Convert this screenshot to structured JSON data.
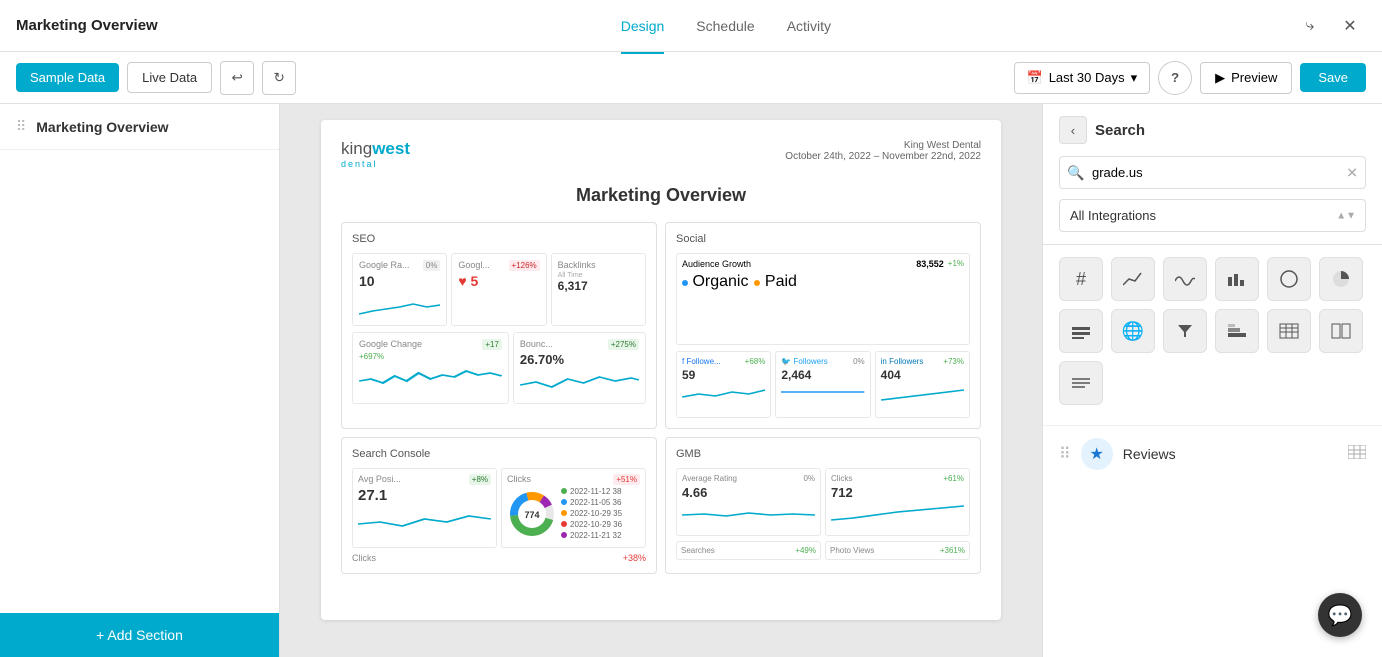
{
  "header": {
    "title": "Marketing Overview",
    "nav": [
      {
        "label": "Design",
        "active": true
      },
      {
        "label": "Schedule",
        "active": false
      },
      {
        "label": "Activity",
        "active": false
      }
    ],
    "share_icon": "⤷",
    "close_icon": "✕"
  },
  "toolbar": {
    "sample_data": "Sample Data",
    "live_data": "Live Data",
    "undo_icon": "↩",
    "redo_icon": "↻",
    "date_range": "Last 30 Days",
    "calendar_icon": "📅",
    "help_icon": "?",
    "preview_label": "Preview",
    "save_label": "Save"
  },
  "sidebar": {
    "title": "Marketing Overview",
    "add_section": "+ Add Section"
  },
  "report": {
    "brand": "kingwest dental",
    "brand_line1": "king",
    "brand_line2": "west",
    "brand_sub": "dental",
    "client": "King West Dental",
    "date_range": "October 24th, 2022 – November 22nd, 2022",
    "title": "Marketing Overview",
    "sections": {
      "seo_label": "SEO",
      "social_label": "Social",
      "search_console_label": "Search Console",
      "gmb_label": "GMB"
    },
    "seo": {
      "google_rank": {
        "name": "Google Ra...",
        "badge": "0%",
        "value": "10"
      },
      "google_ads": {
        "name": "Googl...",
        "badge": "+126%",
        "value": "5",
        "down": true
      },
      "backlinks": {
        "name": "Backlinks",
        "sub": "All Time",
        "badge": "",
        "value": "6,317"
      },
      "google_change": {
        "name": "Google Change",
        "badge": "+17",
        "badge2": "+697%"
      },
      "bounce": {
        "name": "Bounc...",
        "badge": "+275%",
        "value": "26.70%"
      }
    },
    "social": {
      "audience_growth": "Audience Growth",
      "audience_num": "83,552",
      "audience_badge": "+1%",
      "organic_label": "Organic",
      "paid_label": "Paid",
      "followers_fb": {
        "name": "Followe...",
        "badge": "+68%",
        "value": "59"
      },
      "followers_tw": {
        "name": "Followers",
        "badge": "0%",
        "value": "2,464"
      },
      "followers_li": {
        "name": "Followers",
        "badge": "+73%",
        "value": "404"
      }
    },
    "search_console": {
      "avg_pos": {
        "name": "Avg Posi...",
        "badge": "+8%",
        "value": "27.1"
      },
      "clicks": {
        "name": "Clicks",
        "badge": "+51%",
        "donut_value": "774"
      }
    },
    "gmb": {
      "avg_rating": {
        "name": "Average Rating",
        "badge": "0%",
        "value": "4.66"
      },
      "clicks": {
        "name": "Clicks",
        "badge": "+61%",
        "value": "712"
      },
      "searches": {
        "name": "Searches",
        "badge": "+49%"
      },
      "photo_views": {
        "name": "Photo Views",
        "badge": "+361%"
      }
    }
  },
  "right_panel": {
    "back_icon": "‹",
    "title": "Search",
    "search_value": "grade.us",
    "search_placeholder": "Search",
    "clear_icon": "✕",
    "integrations_label": "All Integrations",
    "widget_icons": [
      {
        "name": "hashtag-icon",
        "symbol": "#"
      },
      {
        "name": "line-chart-icon",
        "symbol": "📈"
      },
      {
        "name": "wave-icon",
        "symbol": "∿"
      },
      {
        "name": "bar-chart-icon",
        "symbol": "📊"
      },
      {
        "name": "circle-icon",
        "symbol": "○"
      },
      {
        "name": "pie-chart-icon",
        "symbol": "◕"
      },
      {
        "name": "column-chart-icon",
        "symbol": "▊"
      },
      {
        "name": "globe-icon",
        "symbol": "🌐"
      },
      {
        "name": "filter-icon",
        "symbol": "▽"
      },
      {
        "name": "stacked-bar-icon",
        "symbol": "▤"
      },
      {
        "name": "table-icon2",
        "symbol": "⊞"
      },
      {
        "name": "columns-icon",
        "symbol": "⧉"
      },
      {
        "name": "list-icon",
        "symbol": "≡"
      }
    ],
    "reviews_label": "Reviews",
    "reviews_table_icon": "⊞"
  },
  "colors": {
    "primary": "#00aacc",
    "green": "#4caf50",
    "red": "#e53935",
    "orange": "#ff9800",
    "blue": "#2196f3"
  }
}
